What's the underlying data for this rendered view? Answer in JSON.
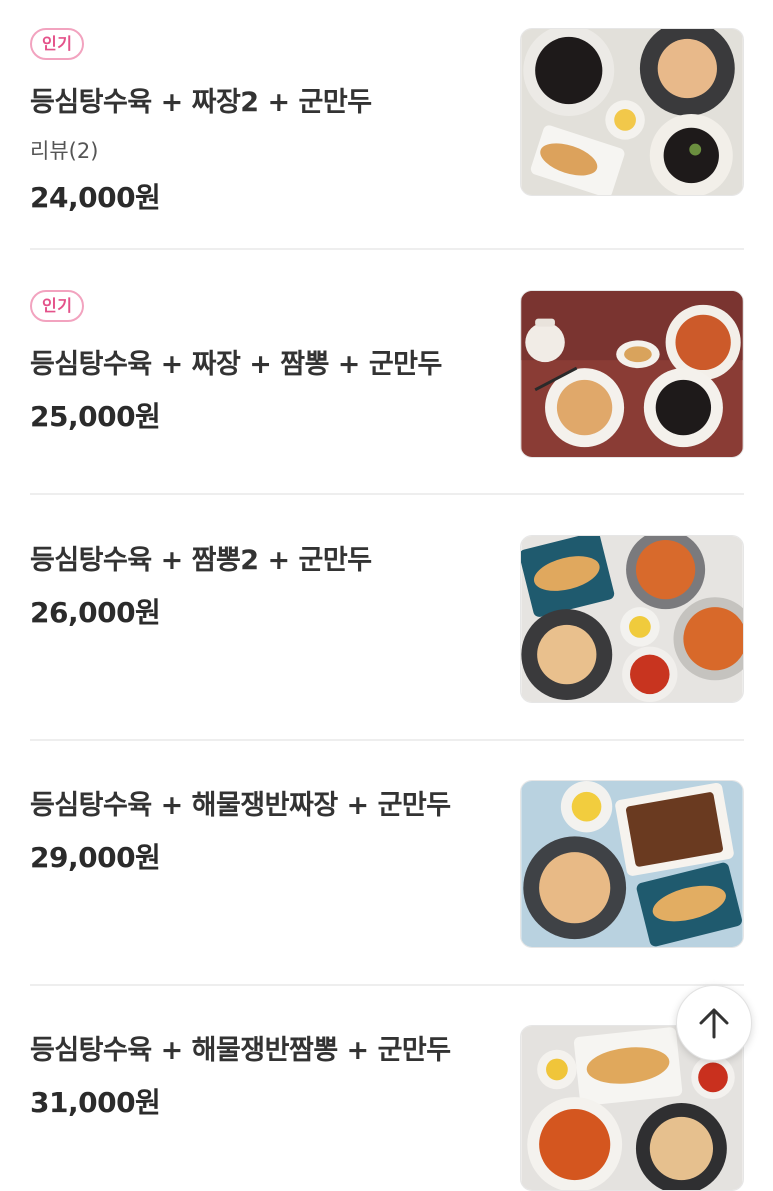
{
  "menu": {
    "items": [
      {
        "badge": "인기",
        "name": "등심탕수육 + 짜장2 + 군만두",
        "review": "리뷰(2)",
        "price": "24,000원",
        "image": "food-photo-jjajang-tangsuyuk-dumplings"
      },
      {
        "badge": "인기",
        "name": "등심탕수육 + 짜장 + 짬뽕 + 군만두",
        "price": "25,000원",
        "image": "food-photo-jjajang-jjamppong-tangsuyuk"
      },
      {
        "name": "등심탕수육 + 짬뽕2 + 군만두",
        "price": "26,000원",
        "image": "food-photo-jjamppong-tangsuyuk-dumplings"
      },
      {
        "name": "등심탕수육 + 해물쟁반짜장 + 군만두",
        "price": "29,000원",
        "image": "food-photo-seafood-jjajang-tray"
      },
      {
        "name": "등심탕수육 + 해물쟁반짬뽕 + 군만두",
        "price": "31,000원",
        "image": "food-photo-seafood-jjamppong-tray"
      }
    ]
  },
  "scroll_top": {
    "icon": "arrow-up-icon"
  },
  "colors": {
    "badge_border": "#f2a3bf",
    "badge_text": "#e4528a",
    "divider": "#eeeeee"
  }
}
